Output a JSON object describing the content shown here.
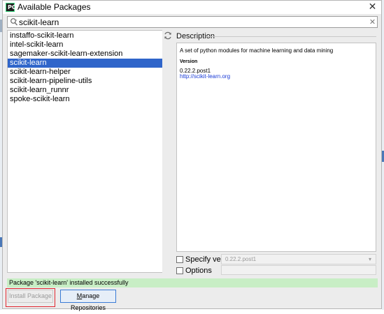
{
  "window": {
    "title": "Available Packages",
    "close_glyph": "✕",
    "logo_glyph": "PC"
  },
  "search": {
    "value": "scikit-learn",
    "placeholder": "",
    "clear_glyph": "✕"
  },
  "packages": [
    {
      "name": "instaffo-scikit-learn",
      "selected": false
    },
    {
      "name": "intel-scikit-learn",
      "selected": false
    },
    {
      "name": "sagemaker-scikit-learn-extension",
      "selected": false
    },
    {
      "name": "scikit-learn",
      "selected": true
    },
    {
      "name": "scikit-learn-helper",
      "selected": false
    },
    {
      "name": "scikit-learn-pipeline-utils",
      "selected": false
    },
    {
      "name": "scikit-learn_runnr",
      "selected": false
    },
    {
      "name": "spoke-scikit-learn",
      "selected": false
    }
  ],
  "description": {
    "label": "Description",
    "summary": "A set of python modules for machine learning and data mining",
    "version_heading": "Version",
    "version": "0.22.2.post1",
    "link": "http://scikit-learn.org"
  },
  "options": {
    "specify_version_label": "Specify version",
    "specify_version_checked": false,
    "version_select_value": "0.22.2.post1",
    "options_label": "Options",
    "options_checked": false,
    "options_value": ""
  },
  "status": {
    "text": "Package 'scikit-learn' installed successfully"
  },
  "buttons": {
    "install_label": "Install Package",
    "manage_mnemonic": "M",
    "manage_rest": "anage Repositories"
  },
  "icons": {
    "search": "search-icon",
    "clear": "clear-search-icon",
    "reload": "refresh-icon",
    "close": "close-icon",
    "chevron": "chevron-down-icon"
  },
  "colors": {
    "selection": "#2f65ca",
    "status_success": "#c8eec5",
    "link": "#1a3bd6",
    "highlight_box": "#e0252e",
    "default_button_border": "#3a7bd5"
  }
}
